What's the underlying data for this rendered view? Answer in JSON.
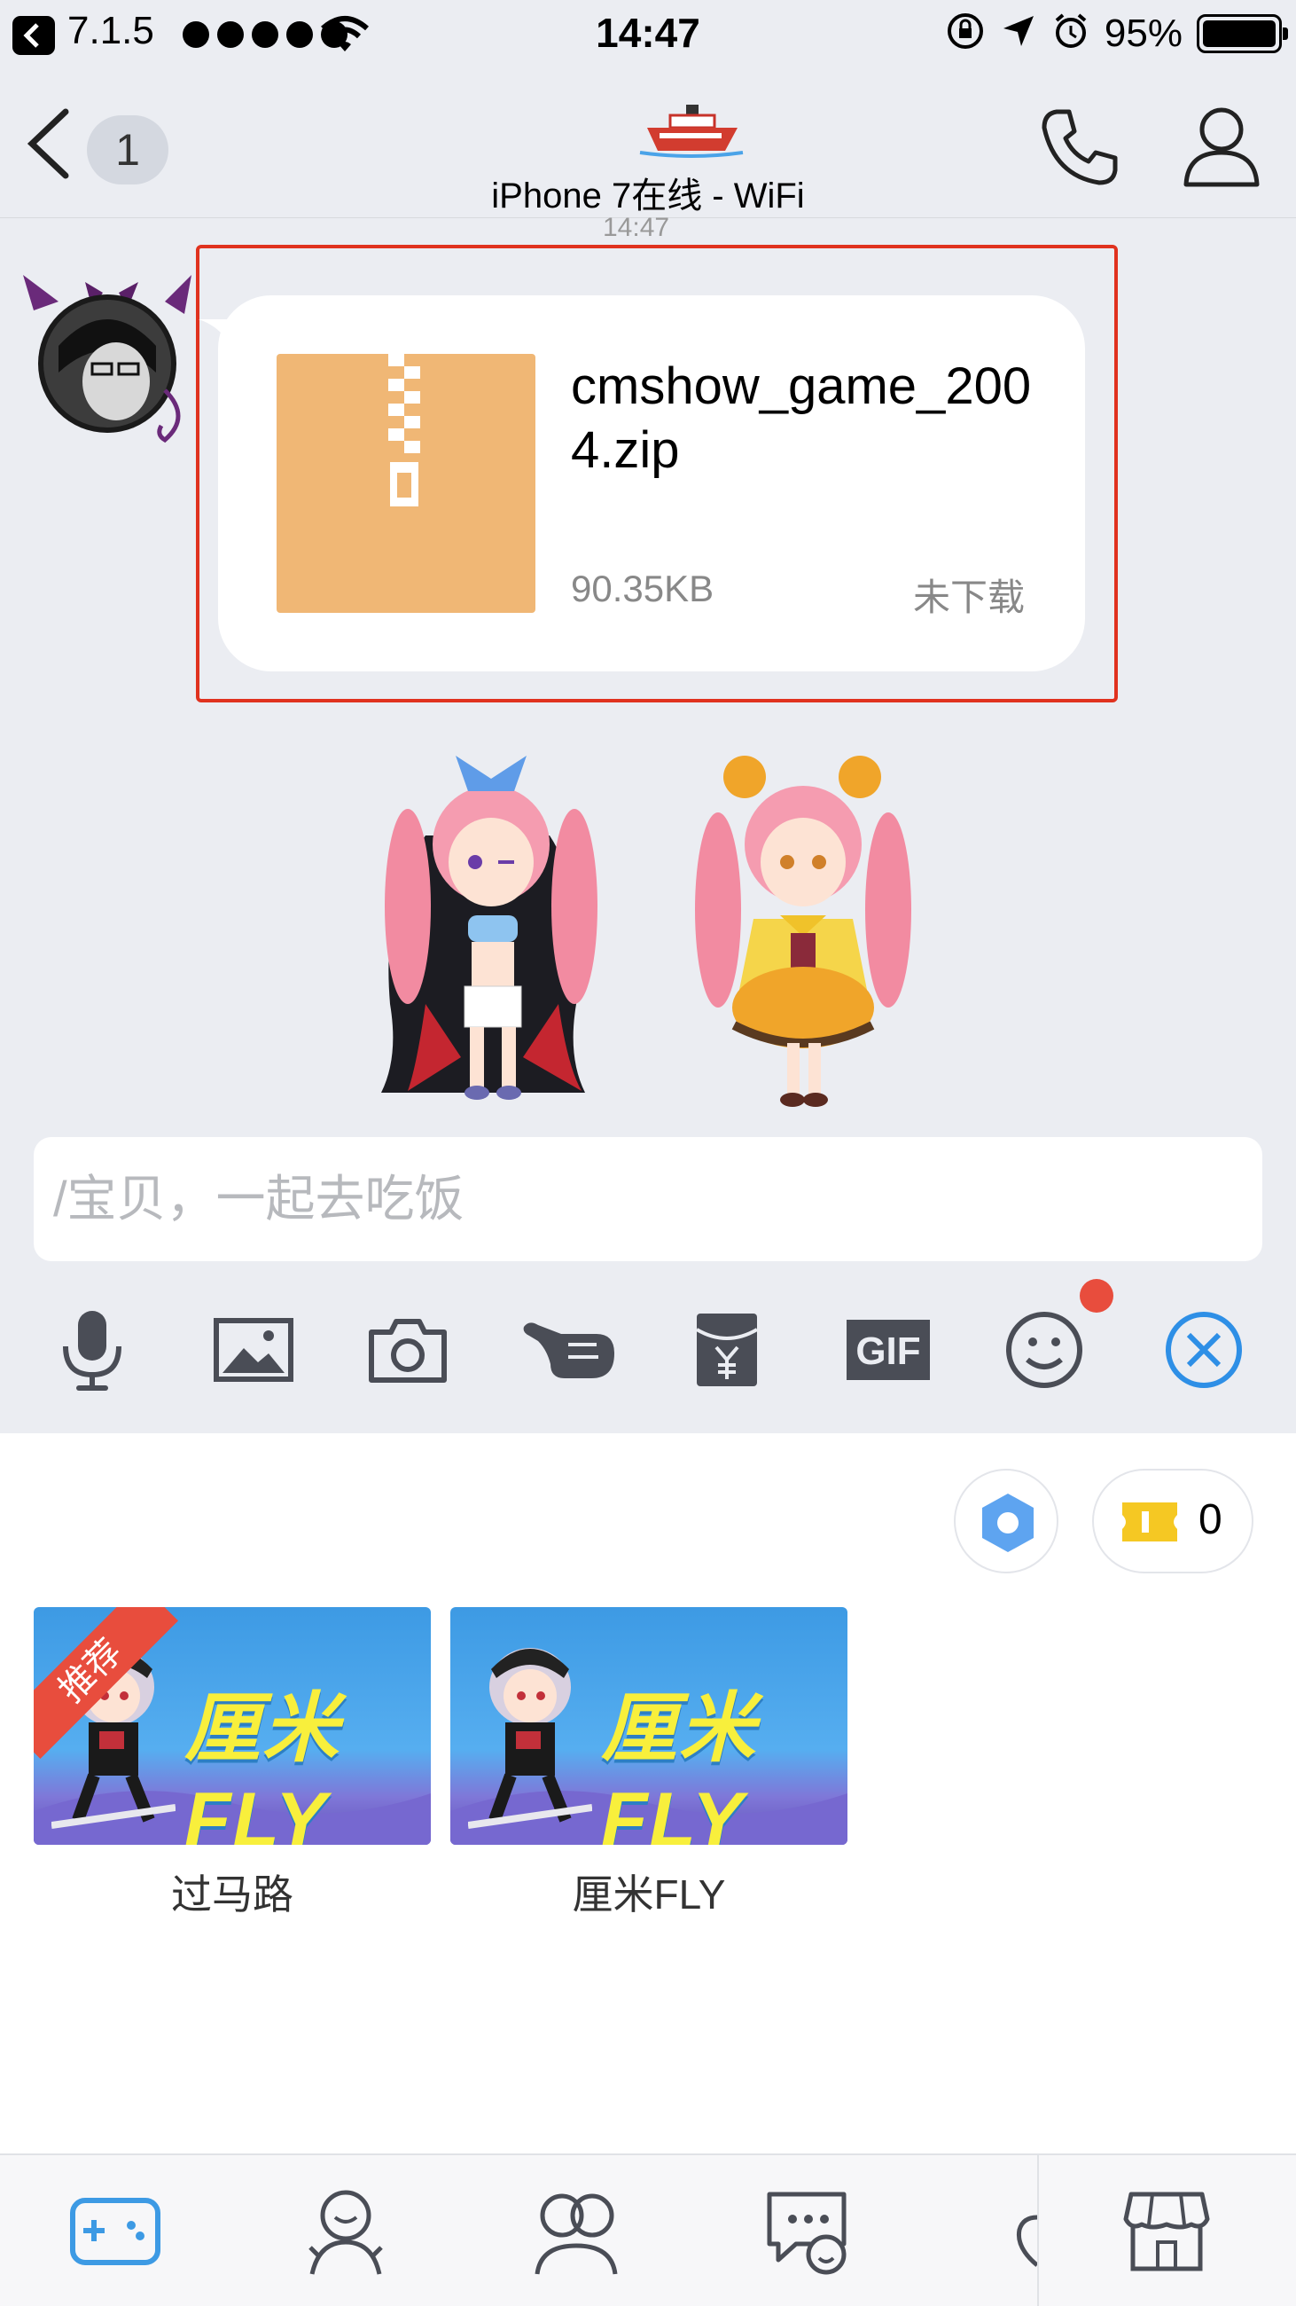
{
  "status_bar": {
    "carrier": "7.1.5",
    "time": "14:47",
    "battery_percent": "95%"
  },
  "nav": {
    "unread_count": "1",
    "subtitle": "iPhone 7在线 - WiFi",
    "icons": [
      "back-icon",
      "ship-icon",
      "phone-icon",
      "contact-icon"
    ]
  },
  "chat": {
    "timestamp_partial": "14:47",
    "file_message": {
      "file_name": "cmshow_game_2004.zip",
      "file_size": "90.35KB",
      "status": "未下载"
    }
  },
  "input": {
    "placeholder": "/宝贝，一起去吃饭"
  },
  "toolbar": {
    "tools": [
      "microphone-icon",
      "image-icon",
      "camera-icon",
      "poke-icon",
      "red-packet-icon",
      "gif-icon",
      "emoji-icon",
      "close-icon"
    ],
    "gif_label": "GIF"
  },
  "panel": {
    "coin_count": "0",
    "games": [
      {
        "title": "过马路",
        "logo": "厘米FLY",
        "badge": "推荐"
      },
      {
        "title": "厘米FLY",
        "logo": "厘米FLY",
        "badge": ""
      }
    ]
  },
  "tabbar": {
    "tabs": [
      "game-controller-icon",
      "avatar-action-icon",
      "duo-avatar-icon",
      "chat-bubble-icon",
      "partial-icon",
      "store-icon"
    ],
    "active_tab": "game-controller-icon"
  },
  "colors": {
    "accent": "#3d9ae4",
    "highlight_border": "#e0321f",
    "file_icon": "#f0b775",
    "background": "#ebedf2"
  }
}
